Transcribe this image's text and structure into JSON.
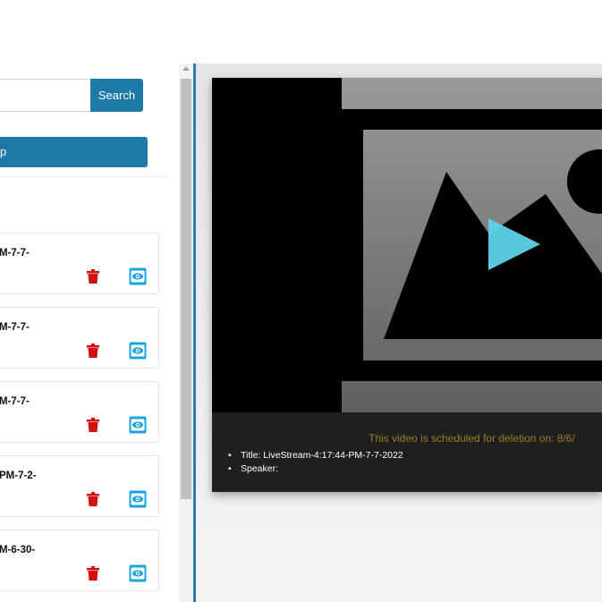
{
  "search": {
    "placeholder": "",
    "value": "",
    "button_label": "Search"
  },
  "primary_button": {
    "label": "p"
  },
  "recordings": [
    {
      "title": "M-7-7-"
    },
    {
      "title": "M-7-7-"
    },
    {
      "title": "M-7-7-"
    },
    {
      "title": "PM-7-2-"
    },
    {
      "title": "M-6-30-"
    }
  ],
  "player": {
    "deletion_notice": "This video is scheduled for deletion on: 8/6/",
    "info": {
      "title_line": "Title: LiveStream-4:17:44-PM-7-7-2022",
      "speaker_line": "Speaker:"
    }
  },
  "icons": {
    "delete": "trash-icon",
    "view": "eye-icon",
    "play": "play-icon",
    "thumbnail": "image-placeholder-icon"
  },
  "colors": {
    "accent": "#1d7aa6",
    "delete": "#d40f0f",
    "view": "#1aa4df",
    "notice": "#9b7d1c",
    "play": "#5ed2ea"
  }
}
